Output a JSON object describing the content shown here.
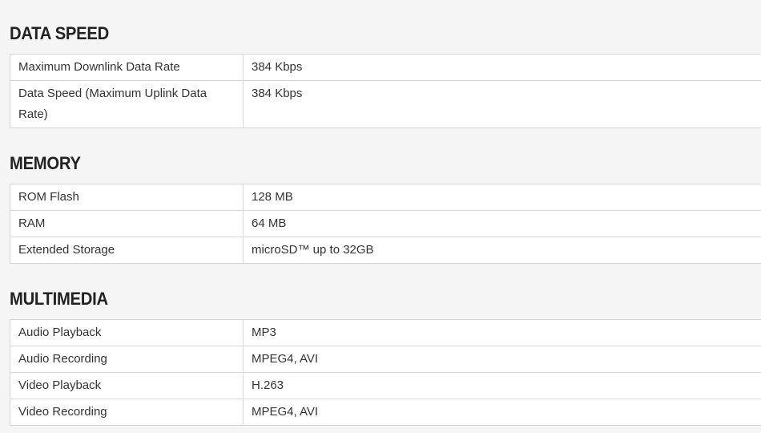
{
  "sections": [
    {
      "title": "DATA SPEED",
      "rows": [
        {
          "label": "Maximum Downlink Data Rate",
          "value": "384 Kbps"
        },
        {
          "label": "Data Speed (Maximum Uplink Data Rate)",
          "value": "384 Kbps"
        }
      ]
    },
    {
      "title": "MEMORY",
      "rows": [
        {
          "label": "ROM Flash",
          "value": "128 MB"
        },
        {
          "label": "RAM",
          "value": "64 MB"
        },
        {
          "label": "Extended Storage",
          "value": "microSD™ up to 32GB"
        }
      ]
    },
    {
      "title": "MULTIMEDIA",
      "rows": [
        {
          "label": "Audio Playback",
          "value": "MP3"
        },
        {
          "label": "Audio Recording",
          "value": "MPEG4, AVI"
        },
        {
          "label": "Video Playback",
          "value": "H.263"
        },
        {
          "label": "Video Recording",
          "value": "MPEG4, AVI"
        }
      ]
    }
  ]
}
